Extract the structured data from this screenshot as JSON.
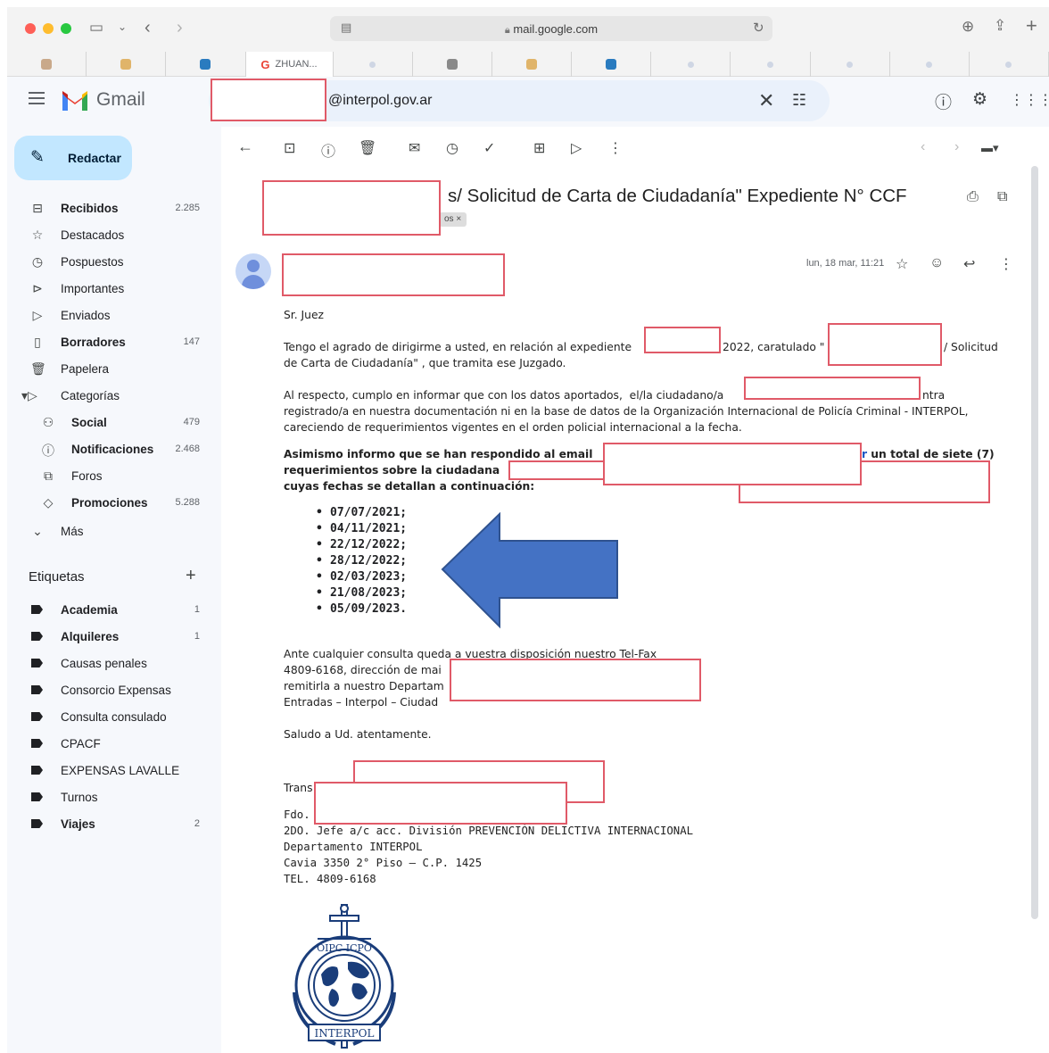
{
  "browser": {
    "url": "mail.google.com",
    "active_tab": "ZHUAN..."
  },
  "app": {
    "name": "Gmail",
    "compose_label": "Redactar",
    "search_query": "@interpol.gov.ar"
  },
  "sidebar": {
    "items": [
      {
        "label": "Recibidos",
        "count": "2.285",
        "icon": "inbox-icon",
        "bold": true
      },
      {
        "label": "Destacados",
        "count": "",
        "icon": "star-icon"
      },
      {
        "label": "Pospuestos",
        "count": "",
        "icon": "clock-icon"
      },
      {
        "label": "Importantes",
        "count": "",
        "icon": "important-icon"
      },
      {
        "label": "Enviados",
        "count": "",
        "icon": "send-icon"
      },
      {
        "label": "Borradores",
        "count": "147",
        "icon": "draft-icon",
        "bold": true
      },
      {
        "label": "Papelera",
        "count": "",
        "icon": "trash-icon"
      },
      {
        "label": "Categorías",
        "count": "",
        "icon": "label-icon"
      },
      {
        "label": "Social",
        "count": "479",
        "icon": "people-icon",
        "bold": true
      },
      {
        "label": "Notificaciones",
        "count": "2.468",
        "icon": "info-icon",
        "bold": true
      },
      {
        "label": "Foros",
        "count": "",
        "icon": "forum-icon"
      },
      {
        "label": "Promociones",
        "count": "5.288",
        "icon": "tag-icon",
        "bold": true
      },
      {
        "label": "Más",
        "count": "",
        "icon": "chevron-down-icon"
      }
    ],
    "labels_title": "Etiquetas",
    "labels": [
      {
        "label": "Academia",
        "count": "1",
        "bold": true
      },
      {
        "label": "Alquileres",
        "count": "1",
        "bold": true
      },
      {
        "label": "Causas penales",
        "count": ""
      },
      {
        "label": "Consorcio Expensas",
        "count": ""
      },
      {
        "label": "Consulta consulado",
        "count": ""
      },
      {
        "label": "CPACF",
        "count": ""
      },
      {
        "label": "EXPENSAS LAVALLE",
        "count": ""
      },
      {
        "label": "Turnos",
        "count": ""
      },
      {
        "label": "Viajes",
        "count": "2",
        "bold": true
      }
    ]
  },
  "message": {
    "subject": "s/ Solicitud de Carta de Ciudadanía\" Expediente N° CCF",
    "chip": "os ×",
    "date": "lun, 18 mar, 11:21",
    "greeting": "Sr. Juez",
    "p1a": "Tengo el agrado de dirigirme a usted, en relación al expediente",
    "p1b": "2022, caratulado \"",
    "p1c": "/ Solicitud",
    "p1d": "de Carta de Ciudadanía\" , que tramita ese Juzgado.",
    "p2a": "Al respecto, cumplo en informar que con los datos aportados,  el/la ciudadano/a",
    "p2b": "ntra",
    "p2c": "registrado/a en nuestra documentación ni en la base de datos de la Organización Internacional de Policía Criminal - INTERPOL,",
    "p2d": "careciendo de requerimientos vigentes en el orden policial internacional a la fecha.",
    "p3a": "Asimismo informo que se han respondido al email",
    "p3b": "r",
    "p3c": " un total de siete (7)",
    "p3d": "requerimientos sobre la ciudadana",
    "p3e": "cuyas fechas se detallan a continuación:",
    "dates": [
      "07/07/2021;",
      "04/11/2021;",
      "22/12/2022;",
      "28/12/2022;",
      "02/03/2023;",
      "21/08/2023;",
      "05/09/2023."
    ],
    "p4a": "Ante cualquier consulta queda a vuestra disposición nuestro Tel-Fax",
    "p4b": "4809-6168, dirección de mai",
    "p4c": "remitirla a nuestro Departam",
    "p4d": "Entradas – Interpol – Ciudad",
    "closing": "Saludo a Ud. atentamente.",
    "trans": "Trans",
    "sig1": "Fdo.",
    "sig2": "2DO. Jefe a/c acc. División PREVENCIÓN DELICTIVA INTERNACIONAL",
    "sig3": "Departamento INTERPOL",
    "sig4": "Cavia 3350 2° Piso – C.P. 1425",
    "sig5": "TEL. 4809-6168",
    "seal_text_top": "OIPC ICPO",
    "seal_text_bottom": "INTERPOL"
  },
  "colors": {
    "redaction_border": "#e05a68",
    "arrow_fill": "#4472c4",
    "compose_bg": "#c2e7ff",
    "sidebar_bg": "#f6f8fc"
  }
}
